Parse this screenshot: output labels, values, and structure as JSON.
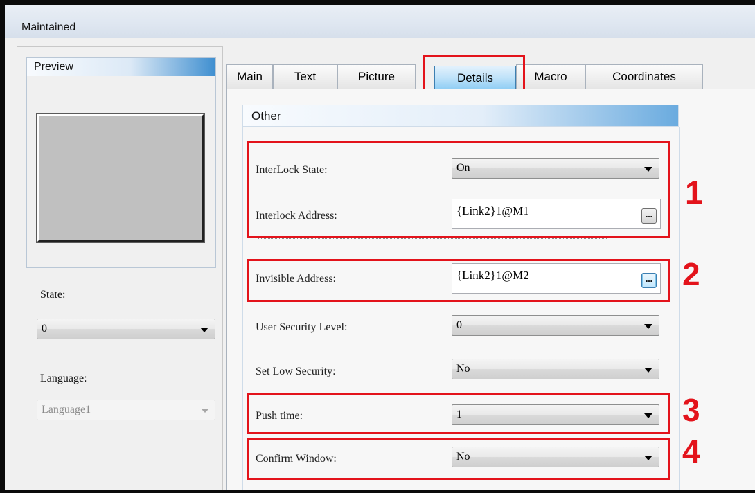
{
  "window": {
    "title": "Maintained"
  },
  "left_panel": {
    "preview_header": "Preview",
    "state_label": "State:",
    "state_value": "0",
    "language_label": "Language:",
    "language_value": "Language1"
  },
  "tabs": [
    {
      "label": "Main",
      "active": false
    },
    {
      "label": "Text",
      "active": false
    },
    {
      "label": "Picture",
      "active": false
    },
    {
      "label": "Details",
      "active": true
    },
    {
      "label": "Macro",
      "active": false
    },
    {
      "label": "Coordinates",
      "active": false
    }
  ],
  "details": {
    "group_title": "Other",
    "interlock_state_label": "InterLock State:",
    "interlock_state_value": "On",
    "interlock_address_label": "Interlock Address:",
    "interlock_address_value": "{Link2}1@M1",
    "invisible_address_label": "Invisible Address:",
    "invisible_address_value": "{Link2}1@M2",
    "user_security_label": "User Security Level:",
    "user_security_value": "0",
    "low_security_label": "Set Low Security:",
    "low_security_value": "No",
    "push_time_label": "Push time:",
    "push_time_value": "1",
    "confirm_window_label": "Confirm Window:",
    "confirm_window_value": "No",
    "browse_button_label": "..."
  },
  "annotations": [
    "1",
    "2",
    "3",
    "4"
  ],
  "colors": {
    "highlight": "#e3131b",
    "accent": "#3f8fd0"
  }
}
